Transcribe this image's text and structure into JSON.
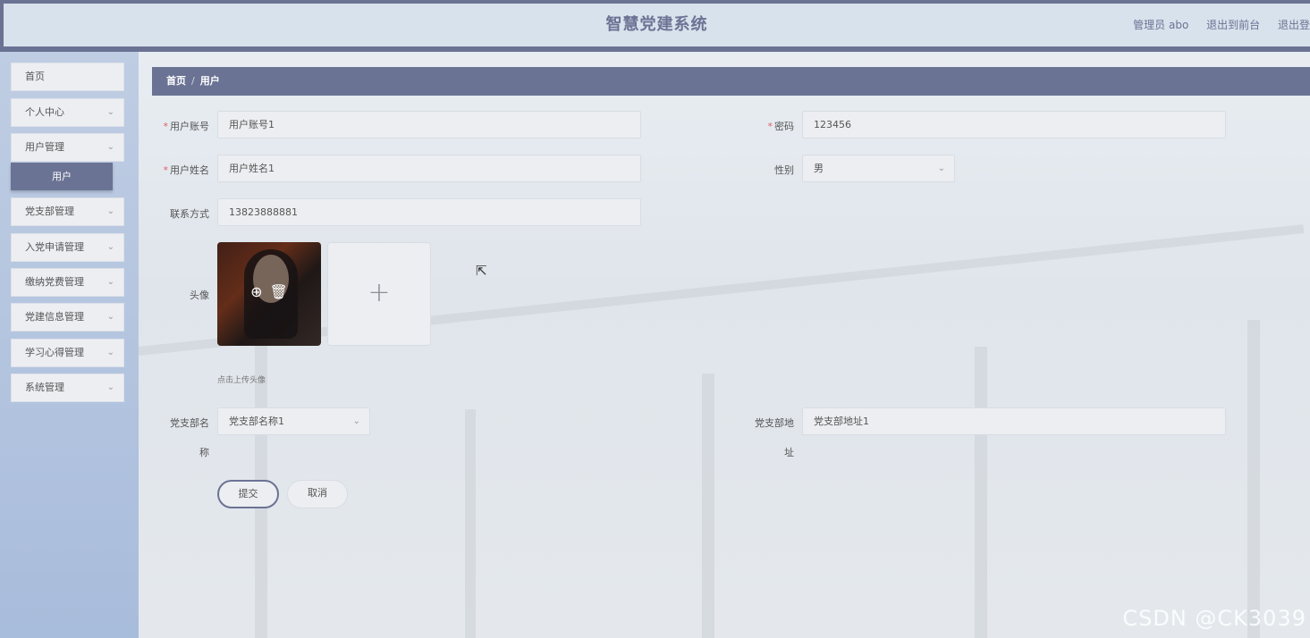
{
  "header": {
    "title": "智慧党建系统",
    "user_label": "管理员 abo",
    "link_front": "退出到前台",
    "link_logout": "退出登"
  },
  "sidebar": {
    "items": [
      {
        "label": "首页",
        "has_chevron": false
      },
      {
        "label": "个人中心",
        "has_chevron": true
      },
      {
        "label": "用户管理",
        "has_chevron": true,
        "expanded": true
      },
      {
        "label": "党支部管理",
        "has_chevron": true
      },
      {
        "label": "入党申请管理",
        "has_chevron": true
      },
      {
        "label": "缴纳党费管理",
        "has_chevron": true
      },
      {
        "label": "党建信息管理",
        "has_chevron": true
      },
      {
        "label": "学习心得管理",
        "has_chevron": true
      },
      {
        "label": "系统管理",
        "has_chevron": true
      }
    ],
    "active_subitem": "用户"
  },
  "breadcrumb": {
    "home": "首页",
    "separator": "/",
    "current": "用户"
  },
  "form": {
    "required_mark": "*",
    "account_label": "用户账号",
    "account_value": "用户账号1",
    "password_label": "密码",
    "password_value": "123456",
    "name_label": "用户姓名",
    "name_value": "用户姓名1",
    "gender_label": "性别",
    "gender_value": "男",
    "contact_label": "联系方式",
    "contact_value": "13823888881",
    "avatar_label": "头像",
    "avatar_hint": "点击上传头像",
    "branch_name_label_1": "党支部名",
    "branch_name_label_2": "称",
    "branch_name_value": "党支部名称1",
    "branch_addr_label_1": "党支部地",
    "branch_addr_label_2": "址",
    "branch_addr_value": "党支部地址1",
    "submit_label": "提交",
    "cancel_label": "取消"
  },
  "icons": {
    "chevron": "chevron-down-icon",
    "zoom": "zoom-in-icon",
    "delete": "trash-icon",
    "upload": "plus-icon"
  },
  "watermark": "CSDN @CK3039",
  "colors": {
    "accent": "#6b7394",
    "required": "#e06060"
  }
}
